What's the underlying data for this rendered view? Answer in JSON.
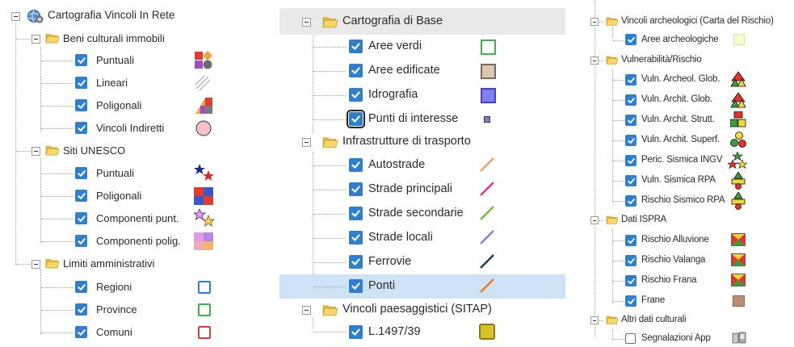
{
  "root": {
    "label": "Cartografia Vincoli In Rete"
  },
  "beni": {
    "label": "Beni culturali immobili",
    "items": [
      "Puntuali",
      "Lineari",
      "Poligonali",
      "Vincoli Indiretti"
    ]
  },
  "unesco": {
    "label": "Siti UNESCO",
    "items": [
      "Puntuali",
      "Poligonali",
      "Componenti punt.",
      "Componenti polig."
    ]
  },
  "limiti": {
    "label": "Limiti amministrativi",
    "items": [
      "Regioni",
      "Province",
      "Comuni"
    ]
  },
  "base": {
    "label": "Cartografia di Base",
    "items": [
      "Aree verdi",
      "Aree edificate",
      "Idrografia",
      "Punti di interesse"
    ]
  },
  "infra": {
    "label": "Infrastrutture di trasporto",
    "items": [
      "Autostrade",
      "Strade principali",
      "Strade secondarie",
      "Strade locali",
      "Ferrovie",
      "Ponti"
    ]
  },
  "paes": {
    "label": "Vincoli paesaggistici (SITAP)",
    "items": [
      "L.1497/39"
    ]
  },
  "arch": {
    "label": "Vincoli archeologici (Carta del Rischio)",
    "items": [
      "Aree archeologiche"
    ]
  },
  "vuln": {
    "label": "Vulnerabilità/Rischio",
    "items": [
      "Vuln. Archeol. Glob.",
      "Vuln. Archit. Glob.",
      "Vuln. Archit. Strutt.",
      "Vuln. Archit. Superf.",
      "Peric. Sismica INGV",
      "Vuln. Sismica RPA",
      "Rischio Sismico RPA"
    ]
  },
  "ispra": {
    "label": "Dati ISPRA",
    "items": [
      "Rischio Alluvione",
      "Rischio Valanga",
      "Rischio Frana",
      "Frane"
    ]
  },
  "altri": {
    "label": "Altri dati culturali",
    "items": [
      "Segnalazioni App"
    ]
  },
  "colors": {
    "checkbox": "#2f7fd1",
    "selected_row": "#cfe2f5",
    "folder": "#f2cf5b",
    "autostrade": "#f4a062",
    "strade_principali": "#e9308f",
    "strade_secondarie": "#6cbd3a",
    "strade_locali": "#8b78d8",
    "ferrovie": "#1c3e4f",
    "ponti": "#e87c22"
  }
}
